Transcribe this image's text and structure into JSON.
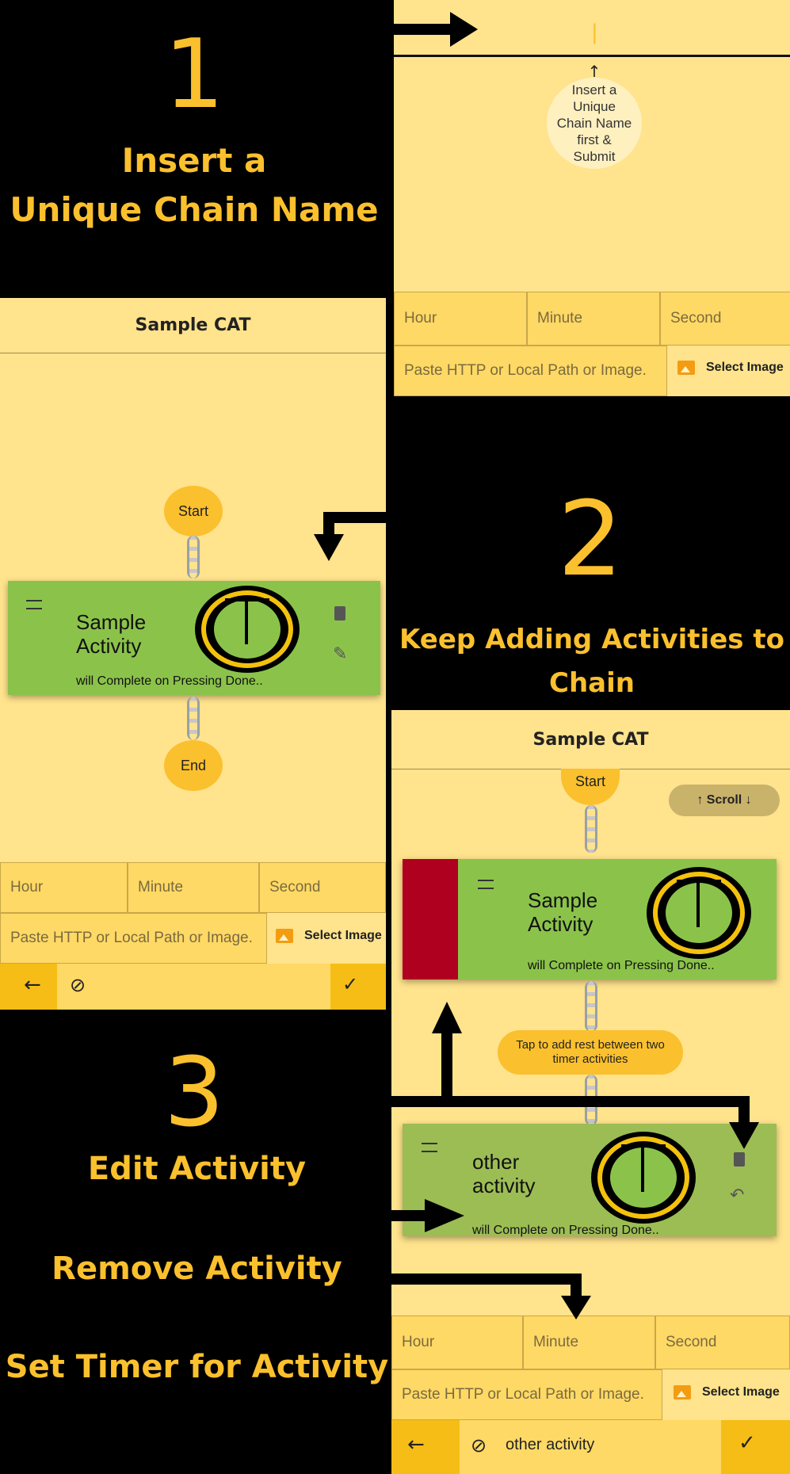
{
  "step1": {
    "number": "1",
    "title_line1": "Insert a",
    "title_line2": "Unique Chain Name"
  },
  "step2": {
    "number": "2",
    "title_line1": "Keep Adding Activities to",
    "title_line2": "Chain"
  },
  "step3": {
    "number": "3",
    "line1": "Edit Activity",
    "line2": "Remove Activity",
    "line3": "Set Timer for Activity"
  },
  "panel1": {
    "cursor": "|",
    "hint": "Insert a Unique Chain Name first & Submit",
    "hour_placeholder": "Hour",
    "minute_placeholder": "Minute",
    "second_placeholder": "Second",
    "image_placeholder": "Paste HTTP or Local Path or Image.",
    "select_image": "Select Image"
  },
  "panel2": {
    "title": "Sample CAT",
    "start": "Start",
    "end": "End",
    "card_title": "Sample Activity",
    "card_sub": "will Complete on Pressing Done..",
    "hour_placeholder": "Hour",
    "minute_placeholder": "Minute",
    "second_placeholder": "Second",
    "image_placeholder": "Paste HTTP or Local Path or Image.",
    "select_image": "Select Image"
  },
  "panel3": {
    "title": "Sample CAT",
    "start": "Start",
    "scroll": "Scroll",
    "card1_title": "Sample Activity",
    "card1_sub": "will Complete on Pressing Done..",
    "rest_hint": "Tap to add rest between two timer activities",
    "card2_title": "other activity",
    "card2_sub": "will Complete on Pressing Done..",
    "hour_placeholder": "Hour",
    "minute_placeholder": "Minute",
    "second_placeholder": "Second",
    "image_placeholder": "Paste HTTP or Local Path or Image.",
    "select_image": "Select Image",
    "activity_name": "other activity"
  },
  "colors": {
    "accent": "#fbc02d",
    "panel": "#ffe38d",
    "card": "#8bc34a",
    "delete": "#b00020"
  }
}
